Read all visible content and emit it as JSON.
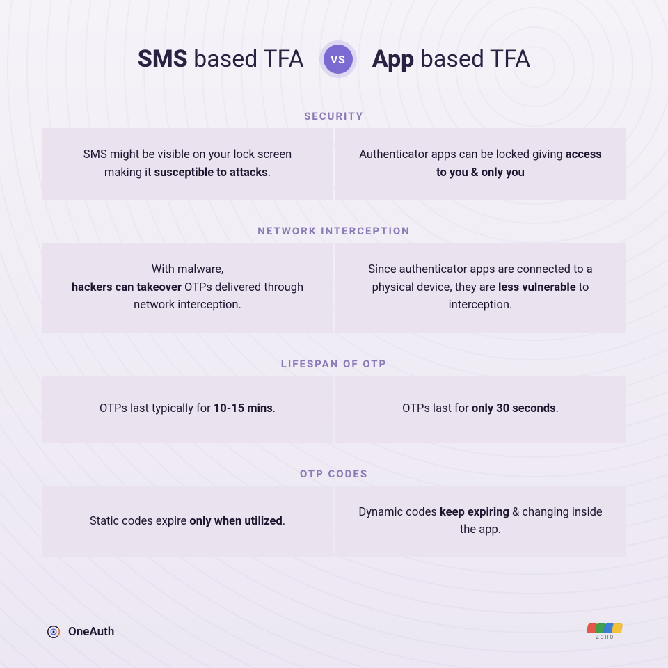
{
  "header": {
    "left_bold": "SMS",
    "left_rest": " based TFA",
    "right_bold": "App",
    "right_rest": " based TFA",
    "vs": "VS"
  },
  "sections": [
    {
      "label": "SECURITY",
      "left_html": "SMS might be visible on your lock screen making it <b>susceptible to attacks</b>.",
      "right_html": "Authenticator apps can be locked giving <b>access to you &amp; only you</b>"
    },
    {
      "label": "NETWORK INTERCEPTION",
      "left_html": "With malware,<br><b>hackers can takeover</b> OTPs delivered through network interception.",
      "right_html": "Since authenticator apps are connected to a physical device, they are <b>less vulnerable</b> to interception."
    },
    {
      "label": "LIFESPAN OF OTP",
      "left_html": "OTPs last typically for <b>10-15 mins</b>.",
      "right_html": "OTPs last for <b>only 30 seconds</b>."
    },
    {
      "label": "OTP CODES",
      "left_html": "Static codes expire <b>only when utilized</b>.",
      "right_html": "Dynamic codes <b>keep expiring</b> &amp; changing inside the app."
    }
  ],
  "footer": {
    "brand_left": "OneAuth",
    "brand_right": "ZOHO",
    "zoho_colors": [
      "#e4584b",
      "#3fa24a",
      "#3c7ed6",
      "#f2c23d"
    ]
  }
}
